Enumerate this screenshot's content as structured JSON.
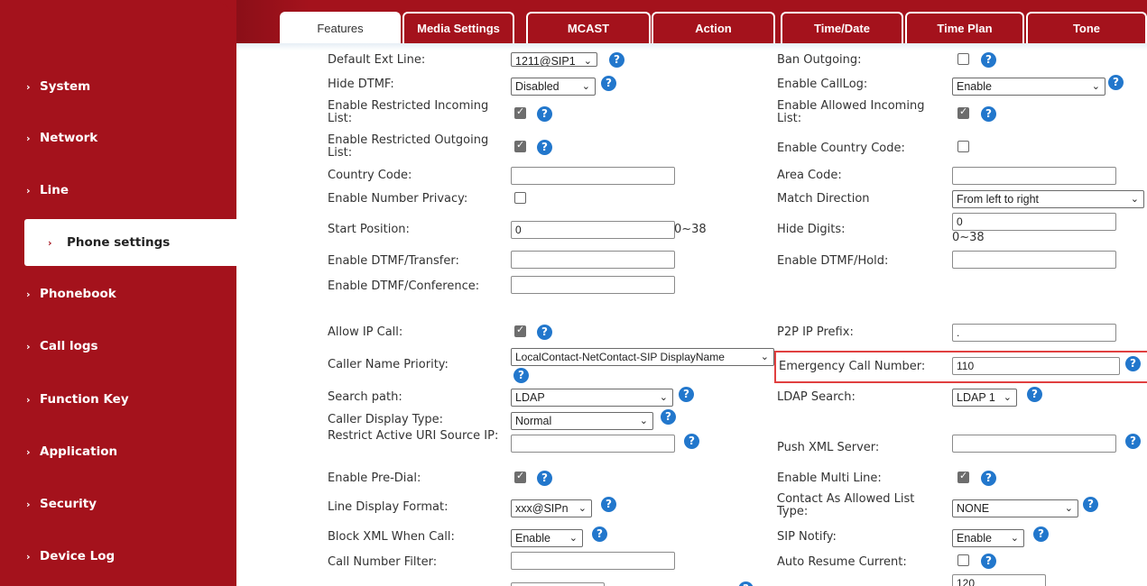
{
  "sidebar": {
    "items": [
      {
        "label": "System",
        "active": false
      },
      {
        "label": "Network",
        "active": false
      },
      {
        "label": "Line",
        "active": false
      },
      {
        "label": "Phone settings",
        "active": true
      },
      {
        "label": "Phonebook",
        "active": false
      },
      {
        "label": "Call logs",
        "active": false
      },
      {
        "label": "Function Key",
        "active": false
      },
      {
        "label": "Application",
        "active": false
      },
      {
        "label": "Security",
        "active": false
      },
      {
        "label": "Device Log",
        "active": false
      }
    ]
  },
  "tabs": [
    {
      "label": "Features",
      "active": true
    },
    {
      "label": "Media Settings",
      "active": false
    },
    {
      "label": "MCAST",
      "active": false
    },
    {
      "label": "Action",
      "active": false
    },
    {
      "label": "Time/Date",
      "active": false
    },
    {
      "label": "Time Plan",
      "active": false
    },
    {
      "label": "Tone",
      "active": false
    }
  ],
  "form": {
    "default_ext_line": {
      "label": "Default Ext Line:",
      "value": "1211@SIP1"
    },
    "ban_outgoing": {
      "label": "Ban Outgoing:",
      "checked": false
    },
    "hide_dtmf": {
      "label": "Hide DTMF:",
      "value": "Disabled"
    },
    "enable_calllog": {
      "label": "Enable CallLog:",
      "value": "Enable"
    },
    "restricted_incoming": {
      "label": "Enable Restricted Incoming List:",
      "checked": true
    },
    "allowed_incoming": {
      "label": "Enable Allowed Incoming List:",
      "checked": true
    },
    "restricted_outgoing": {
      "label": "Enable Restricted Outgoing List:",
      "checked": true
    },
    "enable_country_code": {
      "label": "Enable Country Code:",
      "checked": false
    },
    "country_code": {
      "label": "Country Code:",
      "value": ""
    },
    "area_code": {
      "label": "Area Code:",
      "value": ""
    },
    "number_privacy": {
      "label": "Enable Number Privacy:",
      "checked": false
    },
    "match_direction": {
      "label": "Match Direction",
      "value": "From left to right"
    },
    "start_position": {
      "label": "Start Position:",
      "value": "0",
      "range": "0~38"
    },
    "hide_digits": {
      "label": "Hide Digits:",
      "value": "0",
      "range": "0~38"
    },
    "dtmf_transfer": {
      "label": "Enable DTMF/Transfer:",
      "value": ""
    },
    "dtmf_hold": {
      "label": "Enable DTMF/Hold:",
      "value": ""
    },
    "dtmf_conference": {
      "label": "Enable DTMF/Conference:",
      "value": ""
    },
    "allow_ip_call": {
      "label": "Allow IP Call:",
      "checked": true
    },
    "p2p_ip_prefix": {
      "label": "P2P IP Prefix:",
      "value": "."
    },
    "caller_name_priority": {
      "label": "Caller Name Priority:",
      "value": "LocalContact-NetContact-SIP DisplayName"
    },
    "emergency_call_number": {
      "label": "Emergency Call Number:",
      "value": "110"
    },
    "search_path": {
      "label": "Search path:",
      "value": "LDAP"
    },
    "ldap_search": {
      "label": "LDAP Search:",
      "value": "LDAP 1"
    },
    "caller_display_type": {
      "label": "Caller Display Type:",
      "value": "Normal"
    },
    "restrict_active_uri": {
      "label": "Restrict Active URI Source IP:",
      "value": ""
    },
    "push_xml_server": {
      "label": "Push XML Server:",
      "value": ""
    },
    "pre_dial": {
      "label": "Enable Pre-Dial:",
      "checked": true
    },
    "multi_line": {
      "label": "Enable Multi Line:",
      "checked": true
    },
    "line_display_format": {
      "label": "Line Display Format:",
      "value": "xxx@SIPn"
    },
    "contact_allowed_type": {
      "label": "Contact As Allowed List Type:",
      "value": "NONE"
    },
    "block_xml": {
      "label": "Block XML When Call:",
      "value": "Enable"
    },
    "sip_notify": {
      "label": "SIP Notify:",
      "value": "Enable"
    },
    "call_number_filter": {
      "label": "Call Number Filter:",
      "value": ""
    },
    "auto_resume": {
      "label": "Auto Resume Current:",
      "checked": false
    },
    "partial_value": "120"
  },
  "icons": {
    "help": "?",
    "chevron": "›",
    "dropdown": "⌄"
  },
  "colors": {
    "brand_red": "#a4121c",
    "help_blue": "#2277cc",
    "highlight": "#e04040"
  }
}
